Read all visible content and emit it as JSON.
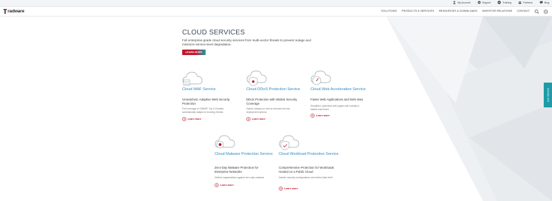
{
  "utility_bar": {
    "items": [
      {
        "label": "My Account",
        "icon": "user-icon"
      },
      {
        "label": "Support",
        "icon": "gear-icon"
      },
      {
        "label": "Training",
        "icon": "graduation-icon"
      },
      {
        "label": "Partners",
        "icon": "people-icon"
      },
      {
        "label": "Blog",
        "icon": "chat-icon"
      }
    ]
  },
  "header": {
    "logo_text": "radware",
    "nav": [
      "SOLUTIONS",
      "PRODUCTS & SERVICES",
      "RESOURCES & DOWNLOADS",
      "INVESTOR RELATIONS",
      "CONTACT"
    ],
    "search_icon": "search-icon",
    "globe_icon": "globe-icon"
  },
  "hero": {
    "title": "CLOUD SERVICES",
    "intro": "Full enterprise-grade cloud security services from multi-vector threats to prevent outage and minimize service-level degradation.",
    "button_label": "LEARN MORE"
  },
  "cards": [
    {
      "icon": "cloud-waf-icon",
      "title": "Cloud WAF Service",
      "subtitle": "Unmatched, Adaptive Web Security Protection",
      "description": "Full coverage of OWASP Top 10 threats, automatically adapts to evolving threats",
      "link": "Learn more"
    },
    {
      "icon": "cloud-ddos-icon",
      "title": "Cloud DDoS Protection Service",
      "subtitle": "DDoS Protection with Widest Security Coverage",
      "description": "Hybrid, always-on and on-demand service deployment options",
      "link": "Learn more"
    },
    {
      "icon": "cloud-acceleration-icon",
      "title": "Cloud Web Acceleration Service",
      "subtitle": "Faster Web Applications and Web sites",
      "description": "Simplified, optimized web pages with industry's fastest load times",
      "link": "Learn more"
    },
    {
      "icon": "cloud-malware-icon",
      "title": "Cloud Malware Protection Service",
      "subtitle": "Zero-Day Malware Protection for Enterprise Networks",
      "description": "Defend organizations against zero-day malware",
      "link": "Learn more"
    },
    {
      "icon": "cloud-workload-icon",
      "title": "Cloud Workload Protection Service",
      "subtitle": "Comprehensive Protection for Workloads Hosted on a Public Cloud",
      "description": "Harden security configurations and detect data theft",
      "link": "Learn more"
    }
  ],
  "side_tab": {
    "label": "Get Started"
  },
  "colors": {
    "accent_red": "#c0182f",
    "accent_teal": "#1d9ba6",
    "link_blue": "#2f86bf"
  }
}
